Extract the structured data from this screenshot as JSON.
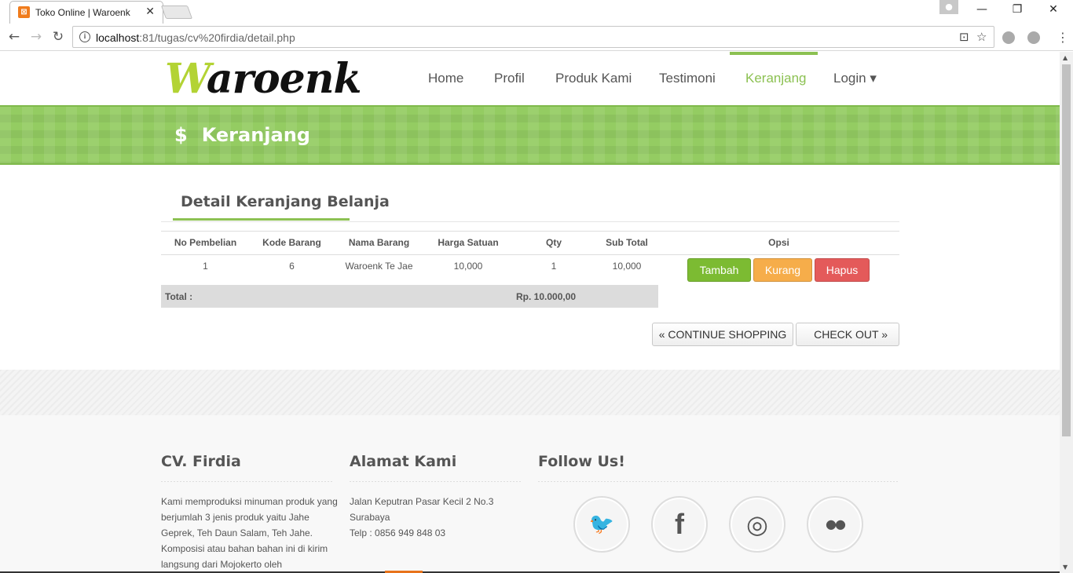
{
  "browser": {
    "tab_title": "Toko Online | Waroenk",
    "tab_close": "✕",
    "url_host": "localhost",
    "url_rest": ":81/tugas/cv%20firdia/detail.php",
    "win_minimize": "—",
    "win_restore": "❐",
    "win_close": "✕"
  },
  "header": {
    "logo_first": "W",
    "logo_rest": "aroenk",
    "nav": [
      {
        "label": "Home"
      },
      {
        "label": "Profil"
      },
      {
        "label": "Produk Kami"
      },
      {
        "label": "Testimoni"
      },
      {
        "label": "Keranjang"
      },
      {
        "label": "Login ▾"
      }
    ]
  },
  "banner": {
    "icon": "$",
    "title": "Keranjang"
  },
  "cart": {
    "title": "Detail Keranjang Belanja",
    "columns": [
      "No Pembelian",
      "Kode Barang",
      "Nama Barang",
      "Harga Satuan",
      "Qty",
      "Sub Total",
      "Opsi"
    ],
    "rows": [
      {
        "no": "1",
        "kode": "6",
        "nama": "Waroenk Te Jae",
        "harga": "10,000",
        "qty": "1",
        "subtotal": "10,000"
      }
    ],
    "actions": {
      "tambah": "Tambah",
      "kurang": "Kurang",
      "hapus": "Hapus"
    },
    "total_label": "Total :",
    "total_value": "Rp. 10.000,00",
    "continue_label": "« CONTINUE SHOPPING",
    "checkout_label": "CHECK OUT »"
  },
  "footer": {
    "col1_title": "CV. Firdia",
    "col1_text": "Kami memproduksi minuman produk yang berjumlah 3 jenis produk yaitu Jahe Geprek, Teh Daun Salam, Teh Jahe. Komposisi atau bahan bahan ini di kirim langsung dari Mojokerto oleh",
    "col2_title": "Alamat Kami",
    "col2_line1": "Jalan Keputran Pasar Kecil 2 No.3",
    "col2_line2": "Surabaya",
    "col2_line3": "Telp : 0856 949 848 03",
    "col3_title": "Follow Us!",
    "social": [
      {
        "icon": "twitter-icon",
        "glyph": "🐦"
      },
      {
        "icon": "facebook-icon",
        "glyph": "f"
      },
      {
        "icon": "dribbble-icon",
        "glyph": "◎"
      },
      {
        "icon": "flickr-icon",
        "glyph": "●●"
      }
    ]
  },
  "colors": {
    "accent_green": "#8cc152",
    "banner_green": "#94cc62",
    "btn_green": "#7cbb32",
    "btn_orange": "#f6ad4a",
    "btn_red": "#e45a5a"
  }
}
